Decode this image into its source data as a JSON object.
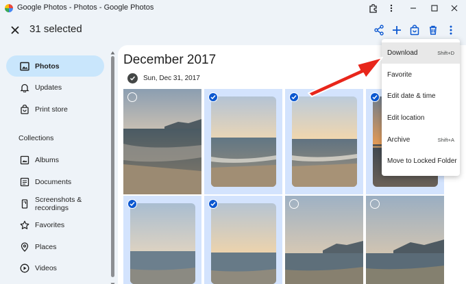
{
  "window": {
    "title": "Google Photos - Photos - Google Photos",
    "controls": [
      "extension-icon",
      "more-vert-icon",
      "minimize-icon",
      "maximize-icon",
      "close-icon"
    ]
  },
  "header": {
    "selected_count": "31 selected",
    "actions": [
      "share-icon",
      "add-icon",
      "shopping-bag-icon",
      "delete-icon",
      "more-vert-icon"
    ],
    "accent_color": "#0b57d0"
  },
  "sidebar": {
    "items": [
      {
        "label": "Photos",
        "icon": "photo-icon",
        "active": true
      },
      {
        "label": "Updates",
        "icon": "bell-icon"
      },
      {
        "label": "Print store",
        "icon": "shopping-bag-icon"
      }
    ],
    "collections_title": "Collections",
    "collections": [
      {
        "label": "Albums",
        "icon": "album-icon"
      },
      {
        "label": "Documents",
        "icon": "document-icon"
      },
      {
        "label": "Screenshots & recordings",
        "label_line1": "Screenshots &",
        "label_line2": "recordings",
        "icon": "phone-screenshot-icon"
      },
      {
        "label": "Favorites",
        "icon": "star-icon"
      },
      {
        "label": "Places",
        "icon": "place-icon"
      },
      {
        "label": "Videos",
        "icon": "play-circle-icon"
      }
    ]
  },
  "main": {
    "month": "December 2017",
    "date_label": "Sun, Dec 31, 2017",
    "photos": [
      {
        "selected": false,
        "scene": "sunset-beach-mountain"
      },
      {
        "selected": true,
        "scene": "beach-waves"
      },
      {
        "selected": true,
        "scene": "beach-waves"
      },
      {
        "selected": true,
        "scene": "sunset-orange"
      },
      {
        "selected": true,
        "scene": "calm-sea"
      },
      {
        "selected": true,
        "scene": "calm-sea"
      },
      {
        "selected": false,
        "scene": "sea-mountain"
      },
      {
        "selected": false,
        "scene": "sea-mountain"
      }
    ]
  },
  "menu": {
    "items": [
      {
        "label": "Download",
        "shortcut": "Shift+D",
        "highlighted": true
      },
      {
        "label": "Favorite",
        "shortcut": ""
      },
      {
        "label": "Edit date & time",
        "shortcut": ""
      },
      {
        "label": "Edit location",
        "shortcut": ""
      },
      {
        "label": "Archive",
        "shortcut": "Shift+A"
      },
      {
        "label": "Move to Locked Folder",
        "shortcut": ""
      }
    ]
  },
  "annotation": {
    "arrow_color": "#e8261b"
  }
}
